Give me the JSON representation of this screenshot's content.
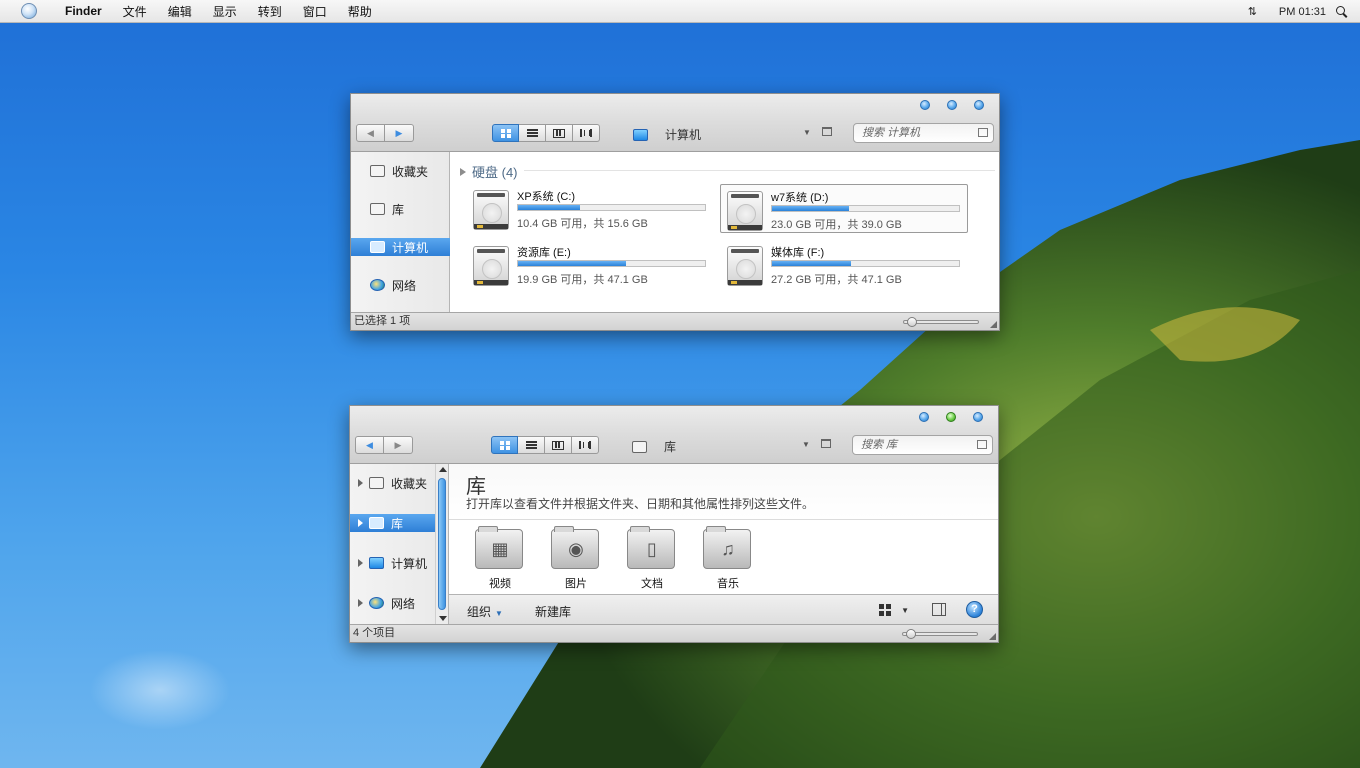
{
  "menubar": {
    "app": "Finder",
    "items": [
      "文件",
      "编辑",
      "显示",
      "转到",
      "窗口",
      "帮助"
    ],
    "clock": "PM 01:31",
    "arrows_glyph": "⇅"
  },
  "window1": {
    "location": "计算机",
    "search_placeholder": "搜索 计算机",
    "sidebar": [
      "收藏夹",
      "库",
      "计算机",
      "网络"
    ],
    "group_title": "硬盘 (4)",
    "drives": [
      {
        "name": "XP系统 (C:)",
        "info": "10.4 GB 可用，共 15.6 GB",
        "used_fraction": 0.33
      },
      {
        "name": "w7系统 (D:)",
        "info": "23.0 GB 可用，共 39.0 GB",
        "used_fraction": 0.41
      },
      {
        "name": "资源库 (E:)",
        "info": "19.9 GB 可用，共 47.1 GB",
        "used_fraction": 0.58
      },
      {
        "name": "媒体库 (F:)",
        "info": "27.2 GB 可用，共 47.1 GB",
        "used_fraction": 0.42
      }
    ],
    "status": "已选择 1 项"
  },
  "window2": {
    "location": "库",
    "search_placeholder": "搜索 库",
    "sidebar": [
      "收藏夹",
      "库",
      "计算机",
      "网络"
    ],
    "title": "库",
    "description": "打开库以查看文件并根据文件夹、日期和其他属性排列这些文件。",
    "folders": [
      {
        "label": "视频",
        "icon": "film-icon",
        "glyph": "▦"
      },
      {
        "label": "图片",
        "icon": "camera-icon",
        "glyph": "◉"
      },
      {
        "label": "文档",
        "icon": "document-icon",
        "glyph": "▯"
      },
      {
        "label": "音乐",
        "icon": "music-note-icon",
        "glyph": "♫"
      }
    ],
    "organize": "组织",
    "new_library": "新建库",
    "help_glyph": "?",
    "status": "4 个项目"
  },
  "colors": {
    "accent": "#3f92e3",
    "sky": "#2a86e4",
    "forest": "#4a7a2a"
  }
}
